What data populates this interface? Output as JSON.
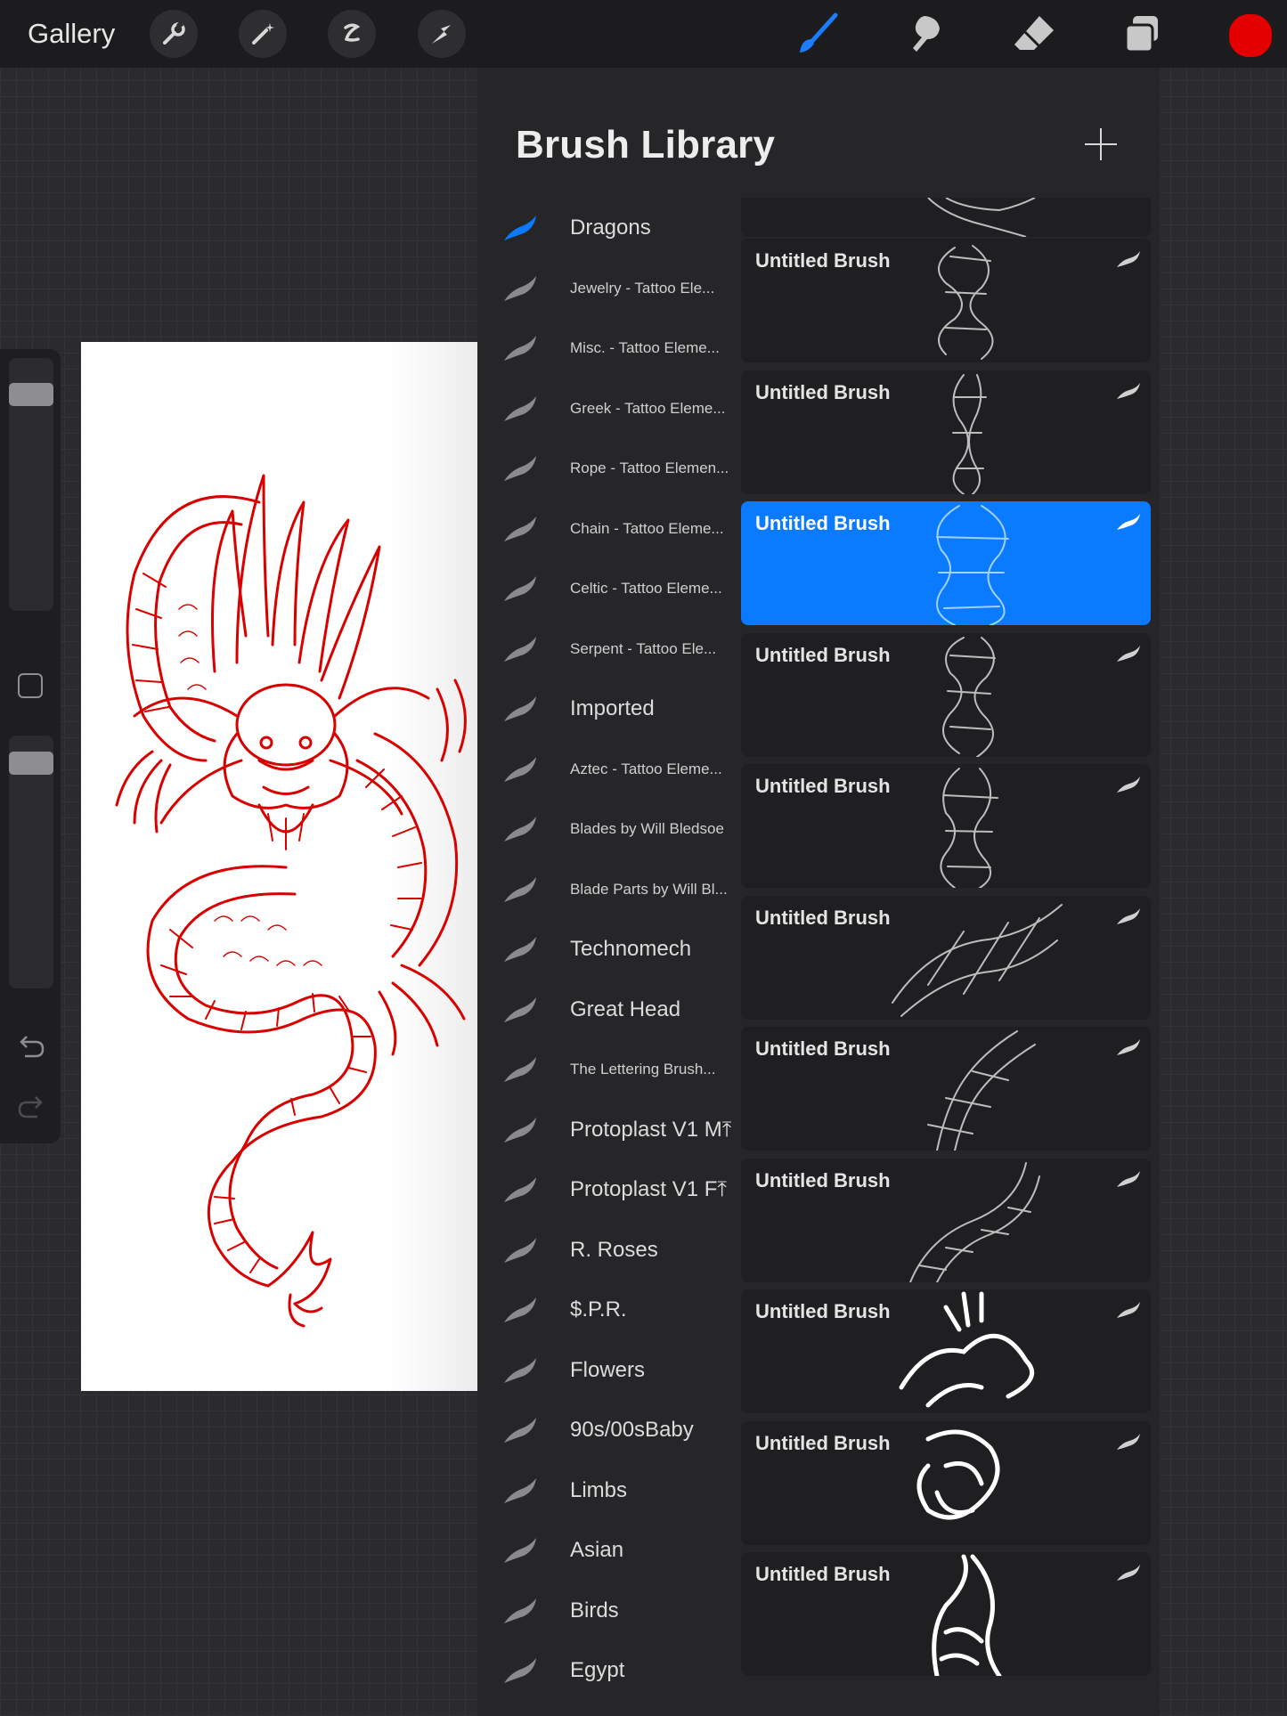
{
  "toolbar": {
    "gallery_label": "Gallery",
    "left_tools": [
      "wrench-icon",
      "magic-wand-icon",
      "selection-icon",
      "transform-arrow-icon"
    ],
    "right_tools": [
      "brush-icon",
      "smudge-icon",
      "eraser-icon",
      "layers-icon"
    ],
    "active_tool": "brush-icon",
    "current_color": "#e50000"
  },
  "sidebar": {
    "undo_icon": "undo-icon",
    "redo_icon": "redo-icon"
  },
  "panel": {
    "title": "Brush Library",
    "add_icon": "plus-icon",
    "brush_sets": [
      {
        "label": "Dragons",
        "size": "large",
        "active": true
      },
      {
        "label": "Jewelry - Tattoo Ele...",
        "size": "small"
      },
      {
        "label": "Misc. - Tattoo Eleme...",
        "size": "small"
      },
      {
        "label": "Greek - Tattoo Eleme...",
        "size": "small"
      },
      {
        "label": "Rope - Tattoo Elemen...",
        "size": "small"
      },
      {
        "label": "Chain - Tattoo Eleme...",
        "size": "small"
      },
      {
        "label": "Celtic - Tattoo Eleme...",
        "size": "small"
      },
      {
        "label": "Serpent - Tattoo Ele...",
        "size": "small"
      },
      {
        "label": "Imported",
        "size": "large"
      },
      {
        "label": "Aztec - Tattoo Eleme...",
        "size": "small"
      },
      {
        "label": "Blades by Will Bledsoe",
        "size": "small"
      },
      {
        "label": "Blade Parts by Will Bl...",
        "size": "small"
      },
      {
        "label": "Technomech",
        "size": "large"
      },
      {
        "label": "Great Head",
        "size": "large"
      },
      {
        "label": "The Lettering Brush...",
        "size": "small"
      },
      {
        "label": "Protoplast V1 M⤒",
        "size": "large"
      },
      {
        "label": "Protoplast V1 F⤒",
        "size": "large"
      },
      {
        "label": "R. Roses",
        "size": "large"
      },
      {
        "label": "$.P.R.",
        "size": "large"
      },
      {
        "label": "Flowers",
        "size": "large"
      },
      {
        "label": "90s/00sBaby",
        "size": "large"
      },
      {
        "label": "Limbs",
        "size": "large"
      },
      {
        "label": "Asian",
        "size": "large"
      },
      {
        "label": "Birds",
        "size": "large"
      },
      {
        "label": "Egypt",
        "size": "large"
      }
    ],
    "brushes": [
      {
        "name": "Untitled Brush",
        "selected": false
      },
      {
        "name": "Untitled Brush",
        "selected": false
      },
      {
        "name": "Untitled Brush",
        "selected": true
      },
      {
        "name": "Untitled Brush",
        "selected": false
      },
      {
        "name": "Untitled Brush",
        "selected": false
      },
      {
        "name": "Untitled Brush",
        "selected": false
      },
      {
        "name": "Untitled Brush",
        "selected": false
      },
      {
        "name": "Untitled Brush",
        "selected": false
      },
      {
        "name": "Untitled Brush",
        "selected": false
      },
      {
        "name": "Untitled Brush",
        "selected": false
      },
      {
        "name": "Untitled Brush",
        "selected": false
      }
    ]
  },
  "colors": {
    "accent": "#0a7bff",
    "toolbar_bg": "#1c1c1e",
    "canvas_art": "#d90000"
  }
}
